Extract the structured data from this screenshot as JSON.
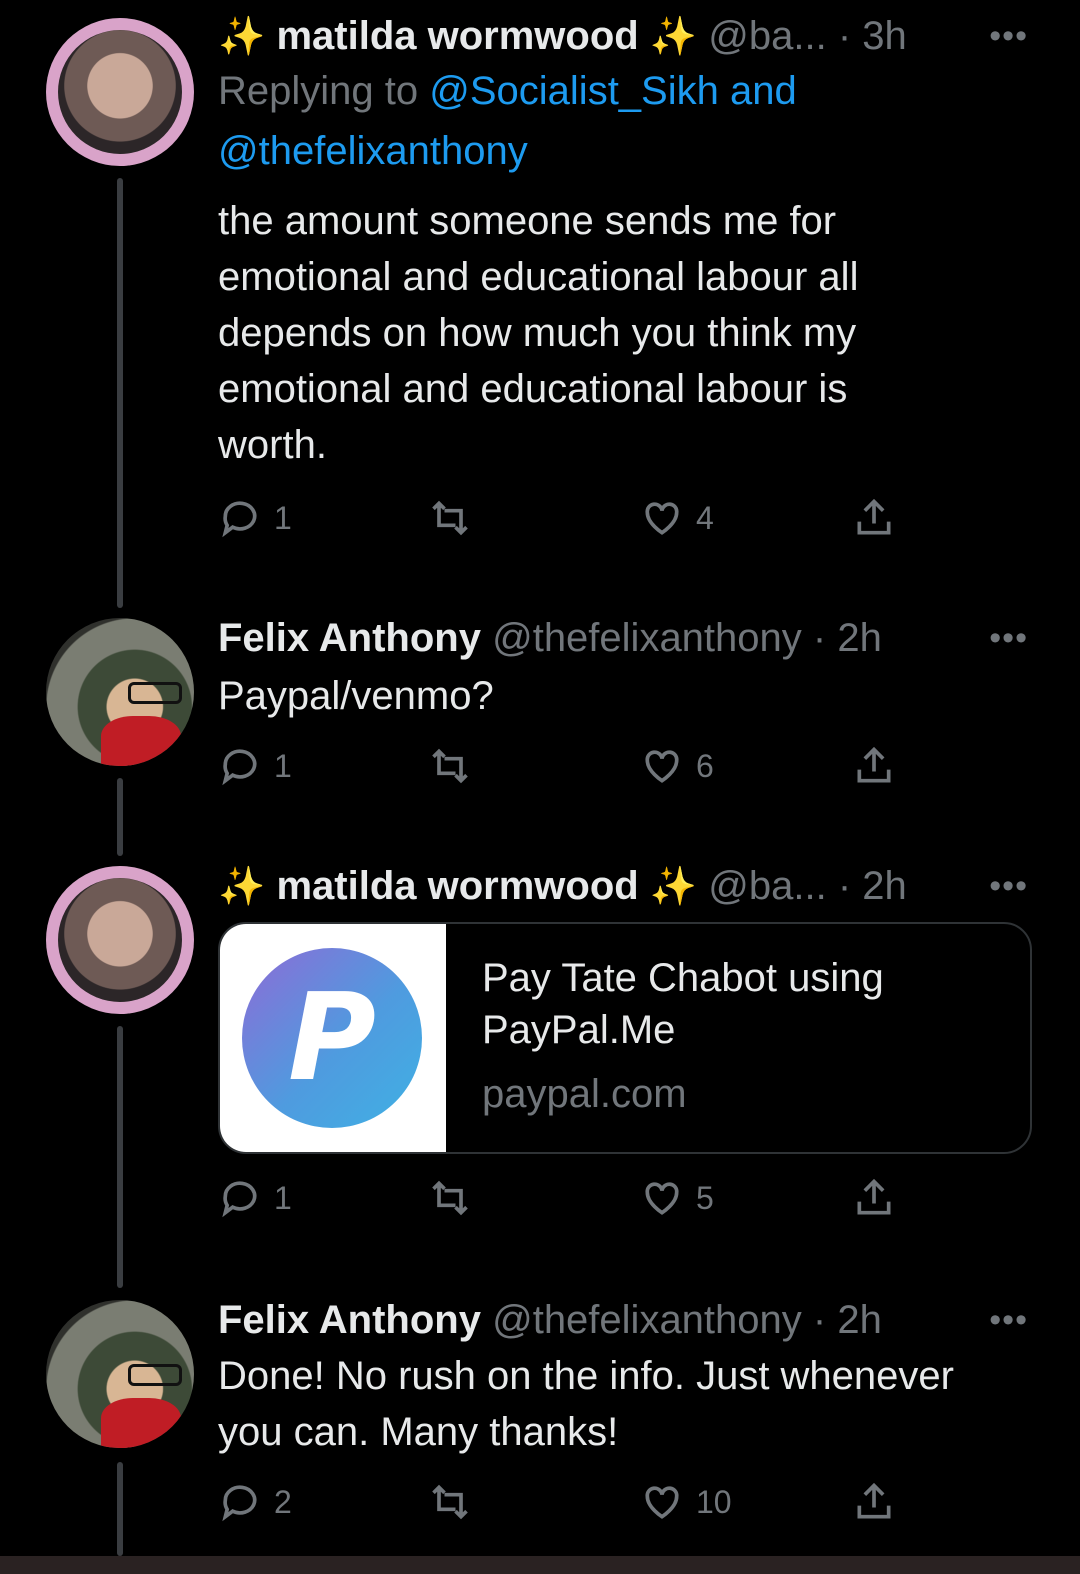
{
  "tweets": [
    {
      "name": "matilda wormwood",
      "handle": "@ba...",
      "time": "· 3h",
      "replying_prefix": "Replying to",
      "replying_mentions": "@Socialist_Sikh and",
      "replying_mentions2": "@thefelixanthony",
      "text_lines": [
        "the amount someone sends me for",
        "emotional and educational labour all",
        "depends on how much you think my",
        "emotional and educational labour is",
        "worth."
      ],
      "replies": "1",
      "likes": "4"
    },
    {
      "name": "Felix Anthony",
      "handle": "@thefelixanthony",
      "time": "· 2h",
      "text": "Paypal/venmo?",
      "replies": "1",
      "likes": "6"
    },
    {
      "name": "matilda wormwood",
      "handle": "@ba...",
      "time": "· 2h",
      "card": {
        "title_line1": "Pay Tate Chabot using",
        "title_line2": "PayPal.Me",
        "domain": "paypal.com",
        "logo_letter": "P"
      },
      "replies": "1",
      "likes": "5"
    },
    {
      "name": "Felix Anthony",
      "handle": "@thefelixanthony",
      "time": "· 2h",
      "text_lines": [
        "Done! No rush on the info. Just whenever",
        "you can. Many thanks!"
      ],
      "replies": "2",
      "likes": "10"
    }
  ],
  "more_label": "•••",
  "sparkle": "✨",
  "icons": {
    "reply": "reply-icon",
    "retweet": "retweet-icon",
    "like": "like-icon",
    "share": "share-icon"
  },
  "colors": {
    "link": "#1d9bf0",
    "muted": "#71767b",
    "background": "#000000"
  }
}
